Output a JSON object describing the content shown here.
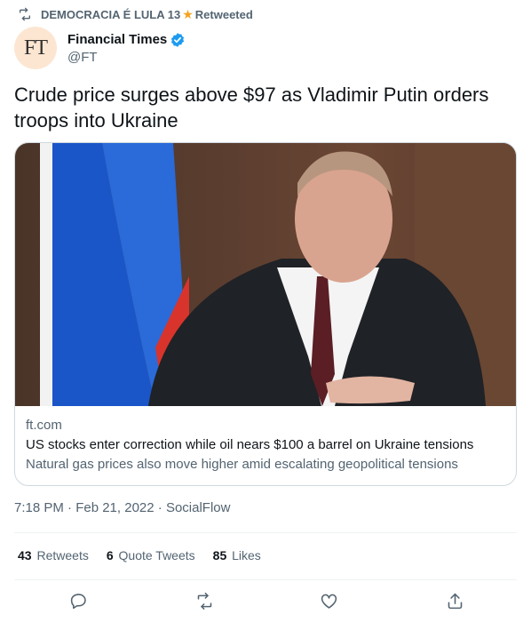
{
  "retweet": {
    "name": "DEMOCRACIA É LULA 13",
    "star": "★",
    "label": "Retweeted"
  },
  "author": {
    "avatar_text": "FT",
    "name": "Financial Times",
    "handle": "@FT"
  },
  "tweet": {
    "text": "Crude price surges above $97 as Vladimir Putin orders troops into Ukraine"
  },
  "card": {
    "domain": "ft.com",
    "title": "US stocks enter correction while oil nears $100 a barrel on Ukraine tensions",
    "description": "Natural gas prices also move higher amid escalating geopolitical tensions"
  },
  "meta": {
    "time": "7:18 PM · Feb 21, 2022 · ",
    "source": "SocialFlow"
  },
  "stats": {
    "retweets_count": "43",
    "retweets_label": "Retweets",
    "quotes_count": "6",
    "quotes_label": "Quote Tweets",
    "likes_count": "85",
    "likes_label": "Likes"
  },
  "colors": {
    "accent": "#1d9bf0",
    "secondary_text": "#536471",
    "border": "#cfd9de"
  }
}
